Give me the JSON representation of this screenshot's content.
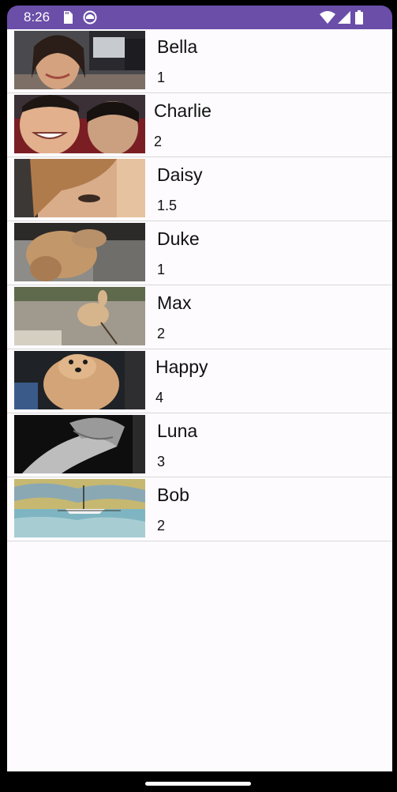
{
  "status_bar": {
    "time": "8:26",
    "icons": [
      "sd-card-icon",
      "app-notification-icon",
      "wifi-icon",
      "signal-icon",
      "battery-icon"
    ],
    "color": "#6a4ea8"
  },
  "list": {
    "items": [
      {
        "name": "Bella",
        "value": "1",
        "thumb": "face-photo"
      },
      {
        "name": "Charlie",
        "value": "2",
        "thumb": "kids-photo"
      },
      {
        "name": "Daisy",
        "value": "1.5",
        "thumb": "closeup-face-photo"
      },
      {
        "name": "Duke",
        "value": "1",
        "thumb": "dog-photo"
      },
      {
        "name": "Max",
        "value": "2",
        "thumb": "dog-photo"
      },
      {
        "name": "Happy",
        "value": "4",
        "thumb": "dog-photo"
      },
      {
        "name": "Luna",
        "value": "3",
        "thumb": "holding-hands-photo"
      },
      {
        "name": "Bob",
        "value": "2",
        "thumb": "boat-photo"
      }
    ]
  }
}
